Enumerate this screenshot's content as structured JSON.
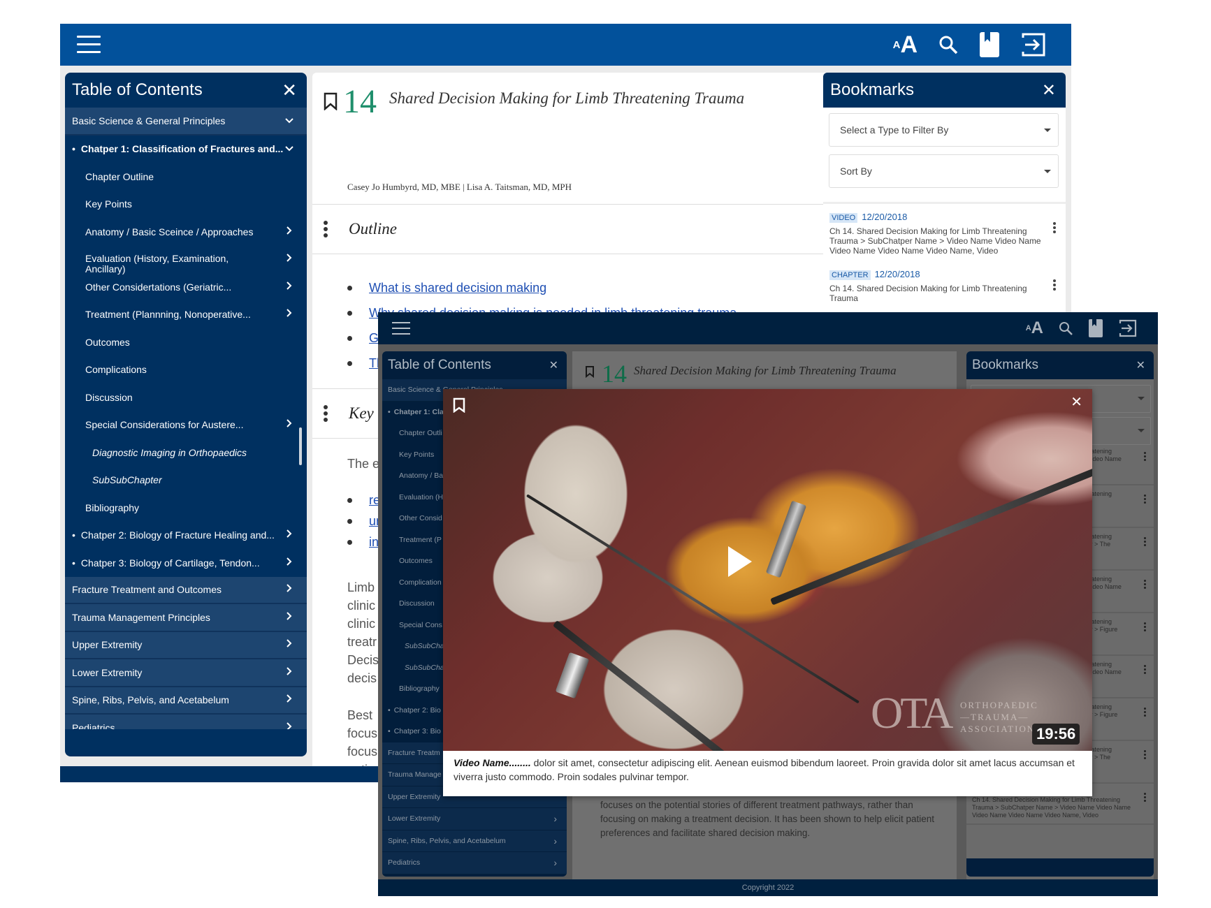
{
  "front": {
    "header": {
      "icons": [
        "menu-icon",
        "text-size-icon",
        "search-icon",
        "bookmarks-icon",
        "exit-icon"
      ],
      "text_size_small": "A",
      "text_size_large": "A"
    },
    "toc": {
      "title": "Table of Contents",
      "items": [
        {
          "label": "Basic Science & General Principles",
          "type": "section",
          "chevron": "down"
        },
        {
          "label": "Chatper 1: Classification of Fractures and...",
          "type": "chapter-active",
          "chevron": "down"
        },
        {
          "label": "Chapter Outline",
          "type": "l2",
          "chevron": ""
        },
        {
          "label": "Key Points",
          "type": "l2",
          "chevron": ""
        },
        {
          "label": "Anatomy / Basic Sceince / Approaches",
          "type": "l2",
          "chevron": "right"
        },
        {
          "label": "Evaluation (History, Examination, Ancillary)",
          "type": "l2",
          "chevron": "right"
        },
        {
          "label": "Other Considertations (Geriatric...",
          "type": "l2",
          "chevron": "right"
        },
        {
          "label": "Treatment (Plannning, Nonoperative...",
          "type": "l2",
          "chevron": "right"
        },
        {
          "label": "Outcomes",
          "type": "l2",
          "chevron": ""
        },
        {
          "label": "Complications",
          "type": "l2",
          "chevron": ""
        },
        {
          "label": "Discussion",
          "type": "l2",
          "chevron": ""
        },
        {
          "label": "Special Considerations for Austere...",
          "type": "l2",
          "chevron": "right"
        },
        {
          "label": "Diagnostic Imaging in Orthopaedics",
          "type": "l3",
          "chevron": ""
        },
        {
          "label": "SubSubChapter",
          "type": "l3",
          "chevron": ""
        },
        {
          "label": "Bibliography",
          "type": "l2",
          "chevron": ""
        },
        {
          "label": "Chatper 2: Biology of Fracture Healing and...",
          "type": "chapter",
          "chevron": "right"
        },
        {
          "label": "Chatper 3: Biology of Cartilage, Tendon...",
          "type": "chapter",
          "chevron": "right"
        },
        {
          "label": "Fracture Treatment and Outcomes",
          "type": "section",
          "chevron": "right"
        },
        {
          "label": "Trauma Management Principles",
          "type": "section",
          "chevron": "right"
        },
        {
          "label": "Upper Extremity",
          "type": "section",
          "chevron": "right"
        },
        {
          "label": "Lower Extremity",
          "type": "section",
          "chevron": "right"
        },
        {
          "label": "Spine, Ribs, Pelvis, and Acetabelum",
          "type": "section",
          "chevron": "right"
        },
        {
          "label": "Pediatrics",
          "type": "section",
          "chevron": "right"
        }
      ]
    },
    "chapter": {
      "number": "14",
      "title": "Shared Decision Making for Limb Threatening Trauma",
      "authors": "Casey Jo Humbyrd, MD, MBE | Lisa A. Taitsman, MD, MPH",
      "outline_title": "Outline",
      "outline_links": [
        "What is shared decision making",
        "Why shared decision making is needed in limb threatening trauma",
        "General approaches to Shared Decision Making",
        "The process of shared decision making in limb threatening trauma"
      ],
      "key_title": "Key",
      "key_intro": "The e",
      "key_links": [
        "re",
        "ur",
        "in"
      ],
      "para1_lines": [
        "Limb",
        "clinic",
        "clinic",
        "treatr",
        "Decis",
        "decis"
      ],
      "para2_lines": [
        "Best",
        "focus",
        "focus",
        "patier"
      ]
    },
    "bookmarks": {
      "title": "Bookmarks",
      "filter_placeholder": "Select a Type to Filter By",
      "sort_placeholder": "Sort By",
      "items": [
        {
          "tag": "VIDEO",
          "date": "12/20/2018",
          "text": "Ch 14. Shared Decision Making for Limb Threatening Trauma > SubChatper Name > Video Name Video Name Video Name Video Name Video Name, Video"
        },
        {
          "tag": "CHAPTER",
          "date": "12/20/2018",
          "text": "Ch 14. Shared Decision Making for Limb Threatening Trauma"
        }
      ]
    }
  },
  "back": {
    "toc": {
      "title": "Table of Contents",
      "items": [
        {
          "label": "Basic Science & General Principles",
          "type": "section"
        },
        {
          "label": "Chatper 1: Cla",
          "type": "chapter-active"
        },
        {
          "label": "Chapter Outli",
          "type": "l2"
        },
        {
          "label": "Key Points",
          "type": "l2"
        },
        {
          "label": "Anatomy / Ba",
          "type": "l2"
        },
        {
          "label": "Evaluation (H",
          "type": "l2"
        },
        {
          "label": "Other Consid",
          "type": "l2"
        },
        {
          "label": "Treatment (P",
          "type": "l2"
        },
        {
          "label": "Outcomes",
          "type": "l2"
        },
        {
          "label": "Complication",
          "type": "l2"
        },
        {
          "label": "Discussion",
          "type": "l2"
        },
        {
          "label": "Special Cons",
          "type": "l2"
        },
        {
          "label": "SubSubCha",
          "type": "l3"
        },
        {
          "label": "SubSubCha",
          "type": "l3"
        },
        {
          "label": "Bibliography",
          "type": "l2"
        },
        {
          "label": "Chatper 2: Bio",
          "type": "chapter"
        },
        {
          "label": "Chatper 3: Bio",
          "type": "chapter"
        },
        {
          "label": "Fracture Treatm",
          "type": "section"
        },
        {
          "label": "Trauma Manage",
          "type": "section"
        },
        {
          "label": "Upper Extremity",
          "type": "section"
        },
        {
          "label": "Lower Extremity",
          "type": "section",
          "chevron": "right"
        },
        {
          "label": "Spine, Ribs, Pelvis, and Acetabelum",
          "type": "section",
          "chevron": "right"
        },
        {
          "label": "Pediatrics",
          "type": "section",
          "chevron": "right"
        }
      ]
    },
    "chapter": {
      "number": "14",
      "title": "Shared Decision Making for Limb Threatening Trauma",
      "paragraph": "Best case/worst case/most likely case is a scenario planning approach that focuses on the potential stories of different treatment pathways, rather than focusing on making a treatment decision. It has been shown to help elicit patient preferences and facilitate shared decision making."
    },
    "bookmarks": {
      "title": "Bookmarks",
      "partial_items": [
        [
          "Threatening",
          "ne Video Name",
          "deo"
        ],
        [
          "Threatening"
        ],
        [
          "Threatening",
          "apter > The"
        ],
        [
          "Threatening",
          "ne Video Name",
          "deo"
        ],
        [
          "Threatening",
          "apter > Figure"
        ],
        [
          "Threatening",
          "ne Video Name",
          "deo"
        ],
        [
          "Threatening",
          "apter > Figure"
        ],
        [
          "Threatening",
          "apter > The"
        ]
      ],
      "last_item": {
        "tag": "VIDEO",
        "date": "12/20/2018",
        "text": "Ch 14. Shared Decision Making for Limb Threatening Trauma > SubChatper Name > Video Name Video Name Video Name Video Name Video Name, Video"
      }
    },
    "footer": "Copyright 2022"
  },
  "video_modal": {
    "duration": "19:56",
    "logo_text": [
      "ORTHOPAEDIC",
      "—TRAUMA—",
      "ASSOCIATION"
    ],
    "logo_mark": "OTA",
    "caption_title": "Video Name........",
    "caption_text": " dolor sit amet, consectetur adipiscing elit. Aenean euismod bibendum laoreet. Proin gravida dolor sit amet lacus accumsan et viverra justo commodo. Proin sodales pulvinar tempor."
  }
}
